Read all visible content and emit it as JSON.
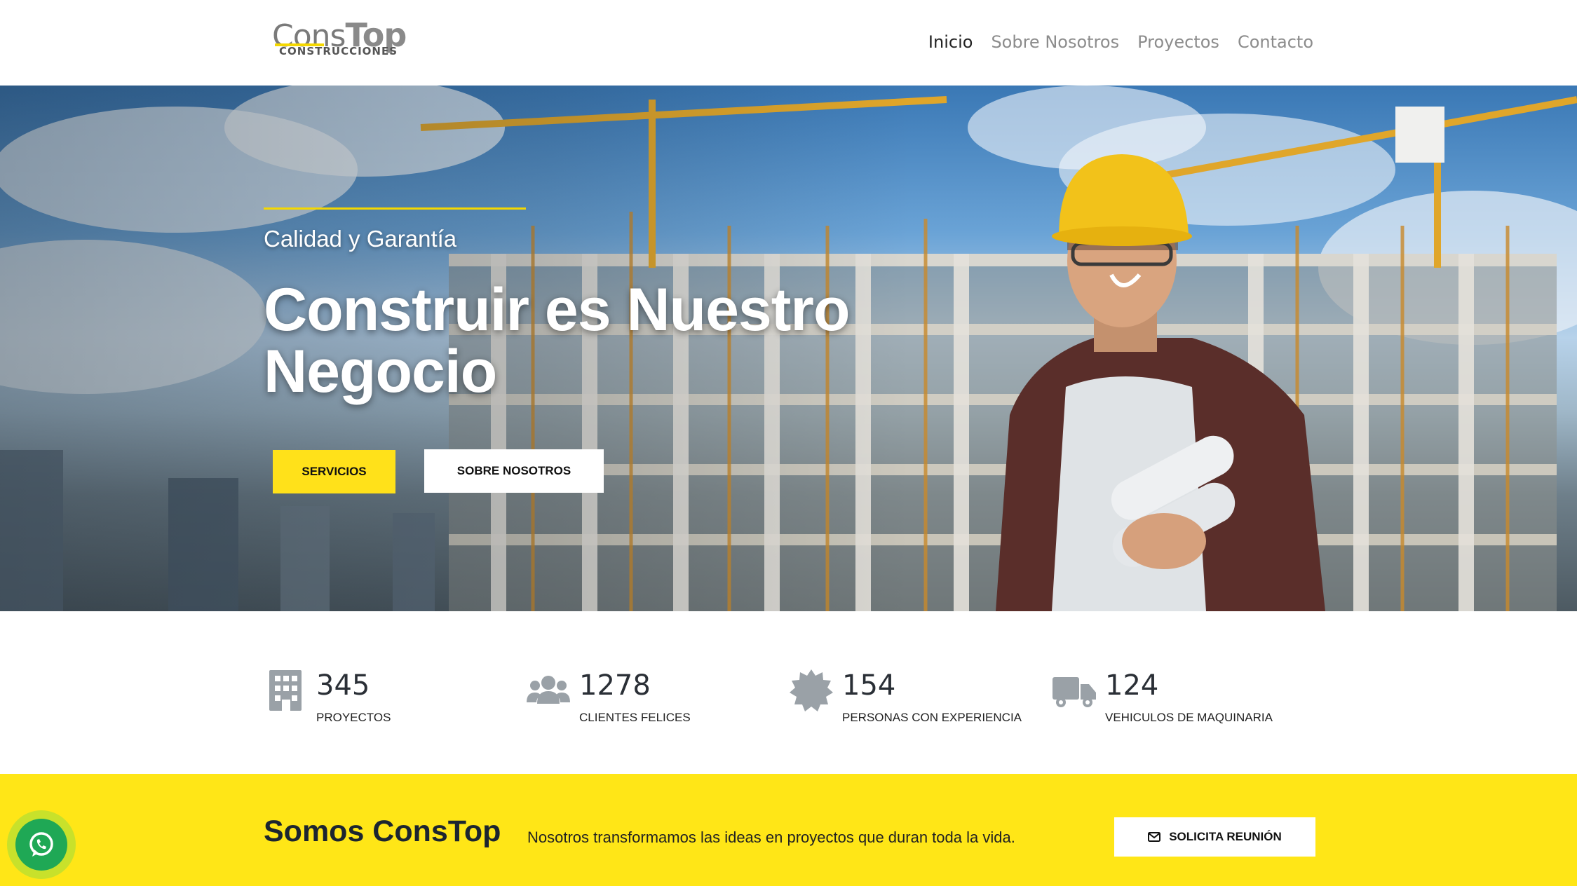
{
  "brand": {
    "name_light": "Cons",
    "name_bold": "Top",
    "tagline": "CONSTRUCCIONES",
    "colors": {
      "accent_yellow": "#ffe617",
      "text_dark": "#1c2530",
      "whatsapp_green": "#1fa855"
    }
  },
  "nav": {
    "items": [
      {
        "label": "Inicio",
        "active": true
      },
      {
        "label": "Sobre Nosotros",
        "active": false
      },
      {
        "label": "Proyectos",
        "active": false
      },
      {
        "label": "Contacto",
        "active": false
      }
    ]
  },
  "hero": {
    "kicker": "Calidad y Garantía",
    "title": "Construir es Nuestro Negocio",
    "primary_button": "SERVICIOS",
    "secondary_button": "SOBRE NOSOTROS",
    "background": "construction-site-with-worker-photo"
  },
  "stats": [
    {
      "icon": "building-icon",
      "value": "345",
      "label": "PROYECTOS"
    },
    {
      "icon": "users-icon",
      "value": "1278",
      "label": "CLIENTES FELICES"
    },
    {
      "icon": "certificate-icon",
      "value": "154",
      "label": "PERSONAS CON EXPERIENCIA"
    },
    {
      "icon": "truck-icon",
      "value": "124",
      "label": "VEHICULOS DE MAQUINARIA"
    }
  ],
  "band": {
    "title": "Somos ConsTop",
    "text": "Nosotros transformamos las ideas en proyectos que duran toda la vida.",
    "button": "SOLICITA REUNIÓN",
    "button_icon": "envelope-icon"
  },
  "whatsapp": {
    "icon": "whatsapp-icon"
  }
}
